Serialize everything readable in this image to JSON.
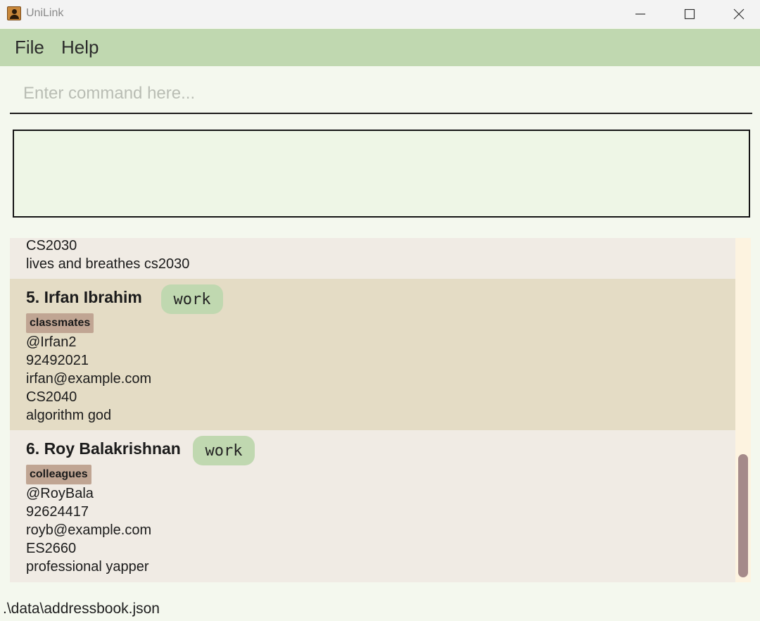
{
  "window": {
    "title": "UniLink",
    "app_icon": "address-book-icon",
    "controls": [
      "minimize-icon",
      "maximize-icon",
      "close-icon"
    ]
  },
  "menu": {
    "file": "File",
    "help": "Help"
  },
  "command": {
    "placeholder": "Enter command here...",
    "value": ""
  },
  "result": {
    "text": ""
  },
  "persons": {
    "partial": {
      "module": "CS2030",
      "remark": "lives and breathes cs2030"
    },
    "p5": {
      "name": "5. Irfan Ibrahim",
      "chip": "work",
      "tag": "classmates",
      "handle": "@Irfan2",
      "phone": "92492021",
      "email": "irfan@example.com",
      "module": "CS2040",
      "remark": "algorithm god"
    },
    "p6": {
      "name": "6. Roy Balakrishnan",
      "chip": "work",
      "tag": "colleagues",
      "handle": "@RoyBala",
      "phone": "92624417",
      "email": "royb@example.com",
      "module": "ES2660",
      "remark": "professional yapper"
    }
  },
  "status": {
    "path": ".\\data\\addressbook.json"
  },
  "colors": {
    "menubar": "#c0d8b0",
    "chip": "#c0d8b0",
    "tag": "#c0a593",
    "card_selected": "#e4dcc5",
    "card": "#f0ebe4",
    "scroll_thumb": "#a58a8a"
  }
}
